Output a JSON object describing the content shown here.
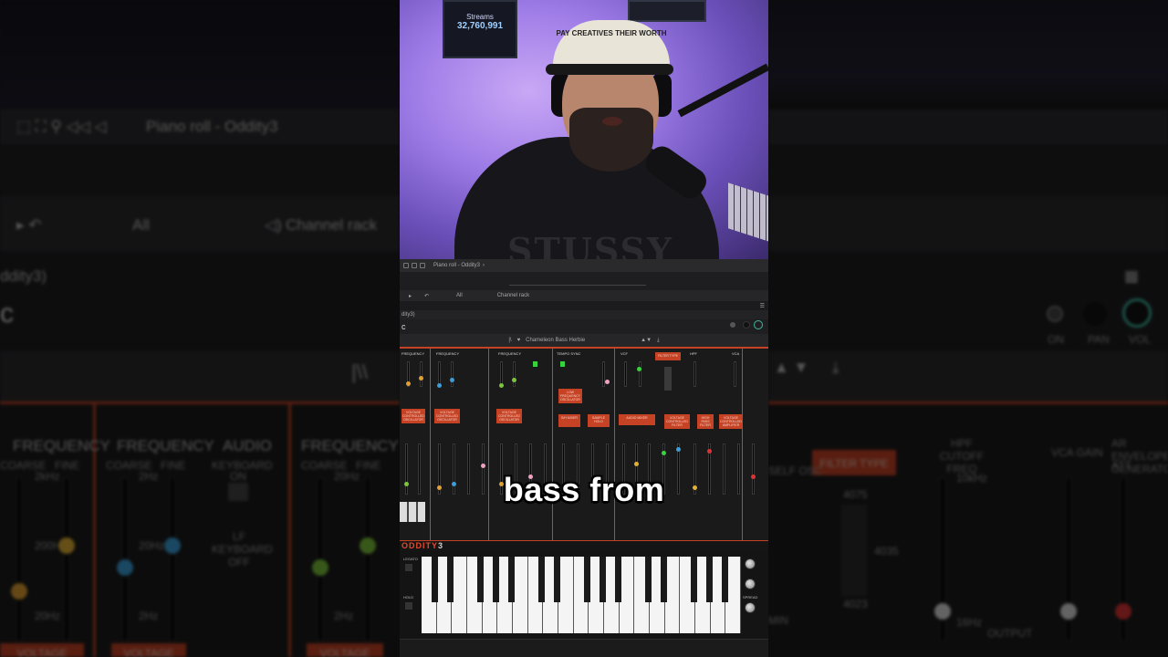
{
  "caption": {
    "text": "bass from"
  },
  "daw": {
    "piano_roll_title": "Piano roll - Oddity3",
    "piano_roll_arrow": "›",
    "channel_rack_label": "Channel rack",
    "filter_all": "All",
    "instrument_short": "dity3)",
    "preset_name": "Chameleon Bass Herbie",
    "logo_letter": "c"
  },
  "background_left": {
    "piano_roll_title": "Piano roll - Oddity3",
    "channel_rack_label": "Channel rack",
    "filter_all": "All",
    "instrument_short": "ddity3)",
    "logo_letter": "c",
    "labels": [
      "FREQUENCY",
      "FREQUENCY",
      "AUDIO",
      "FREQUENCY"
    ],
    "sub_labels": [
      "COARSE",
      "FINE",
      "COARSE",
      "FINE",
      "KEYBOARD",
      "COARSE",
      "FINE"
    ],
    "keyboard_on": "ON",
    "lf_keyboard_off": "LF KEYBOARD OFF",
    "hz_labels": [
      "2kHz",
      "200Hz",
      "20Hz",
      "2Hz",
      "20Hz",
      "2Hz",
      "20Hz",
      "2Hz"
    ],
    "voltage": [
      "VOLTAGE",
      "VOLTAGE",
      "VOLTAGE"
    ]
  },
  "background_right": {
    "on_label": "ON",
    "pan_label": "PAN",
    "vol_label": "VOL",
    "filter_type": "FILTER TYPE",
    "hpf_label": "HPF CUTOFF FREQ",
    "vca_label": "VCA GAIN",
    "ar_label": "AR ENVELOPE GENERATOR",
    "att_label": "ATT",
    "self_osc": "SELF OSC",
    "min_label": "MIN",
    "output_label": "OUTPUT",
    "values": [
      "4075",
      "4035",
      "4023"
    ],
    "freq_labels": [
      "10kHz",
      "16Hz"
    ]
  },
  "synth": {
    "brand": "ODDITY",
    "brand_num": "3",
    "modules": [
      {
        "title": "FREQUENCY",
        "box": "VOLTAGE CONTROLLED OSCILLATOR"
      },
      {
        "title": "FREQUENCY",
        "box": "VOLTAGE CONTROLLED OSCILLATOR"
      },
      {
        "title": "FREQUENCY",
        "box": "VOLTAGE CONTROLLED OSCILLATOR"
      },
      {
        "title": "TEMPO SYNC",
        "box": "LOW FREQUENCY OSCILLATOR"
      },
      {
        "title": "VCF",
        "box": "VOLTAGE CONTROLLED FILTER"
      },
      {
        "title": "HPF",
        "box": "HIGH PASS FILTER"
      },
      {
        "title": "VCA",
        "box": "VOLTAGE CONTROLLED AMPLIFIER"
      }
    ],
    "filter_type_btn": "FILTER TYPE",
    "sh_mixer": "S/H MIXER",
    "sample_hold": "SAMPLE HOLD",
    "audio_mixer": "AUDIO MIXER",
    "side_labels": [
      "LEGATO",
      "HOLD",
      "SPREAD"
    ]
  },
  "poster": {
    "label": "Streams",
    "value": "32,760,991"
  },
  "cap_text": "PAY CREATIVES THEIR WORTH",
  "hoodie_text": "STUSSY",
  "colors": {
    "accent": "#c64224",
    "led": "#37d33f",
    "caption": "#ffffff"
  }
}
